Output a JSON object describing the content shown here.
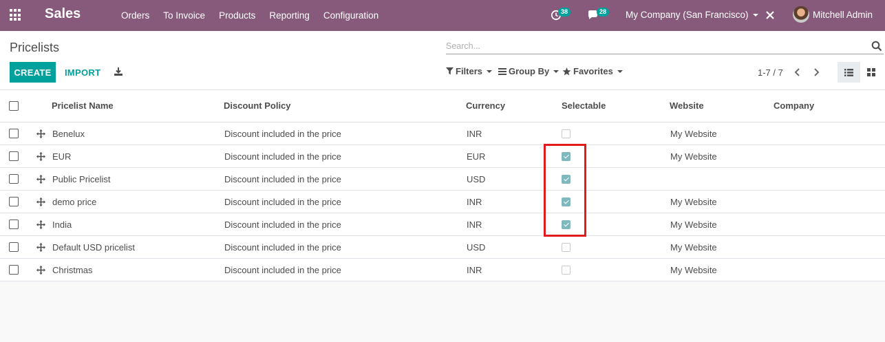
{
  "navbar": {
    "app_name": "Sales",
    "menu": [
      "Orders",
      "To Invoice",
      "Products",
      "Reporting",
      "Configuration"
    ],
    "activity_count": "38",
    "messages_count": "28",
    "company": "My Company (San Francisco)",
    "user": "Mitchell Admin",
    "brand_color": "#875a7b"
  },
  "control_panel": {
    "breadcrumb": "Pricelists",
    "search_placeholder": "Search...",
    "create_label": "CREATE",
    "import_label": "IMPORT",
    "filters_label": "Filters",
    "groupby_label": "Group By",
    "favorites_label": "Favorites",
    "pager": "1-7 / 7",
    "accent_color": "#00a09d"
  },
  "table": {
    "headers": [
      "Pricelist Name",
      "Discount Policy",
      "Currency",
      "Selectable",
      "Website",
      "Company"
    ],
    "rows": [
      {
        "name": "Benelux",
        "policy": "Discount included in the price",
        "currency": "INR",
        "selectable": false,
        "website": "My Website",
        "company": ""
      },
      {
        "name": "EUR",
        "policy": "Discount included in the price",
        "currency": "EUR",
        "selectable": true,
        "website": "My Website",
        "company": ""
      },
      {
        "name": "Public Pricelist",
        "policy": "Discount included in the price",
        "currency": "USD",
        "selectable": true,
        "website": "",
        "company": ""
      },
      {
        "name": "demo price",
        "policy": "Discount included in the price",
        "currency": "INR",
        "selectable": true,
        "website": "My Website",
        "company": ""
      },
      {
        "name": "India",
        "policy": "Discount included in the price",
        "currency": "INR",
        "selectable": true,
        "website": "My Website",
        "company": ""
      },
      {
        "name": "Default USD pricelist",
        "policy": "Discount included in the price",
        "currency": "USD",
        "selectable": false,
        "website": "My Website",
        "company": ""
      },
      {
        "name": "Christmas",
        "policy": "Discount included in the price",
        "currency": "INR",
        "selectable": false,
        "website": "My Website",
        "company": ""
      }
    ]
  },
  "highlight_color": "#e11b1b"
}
